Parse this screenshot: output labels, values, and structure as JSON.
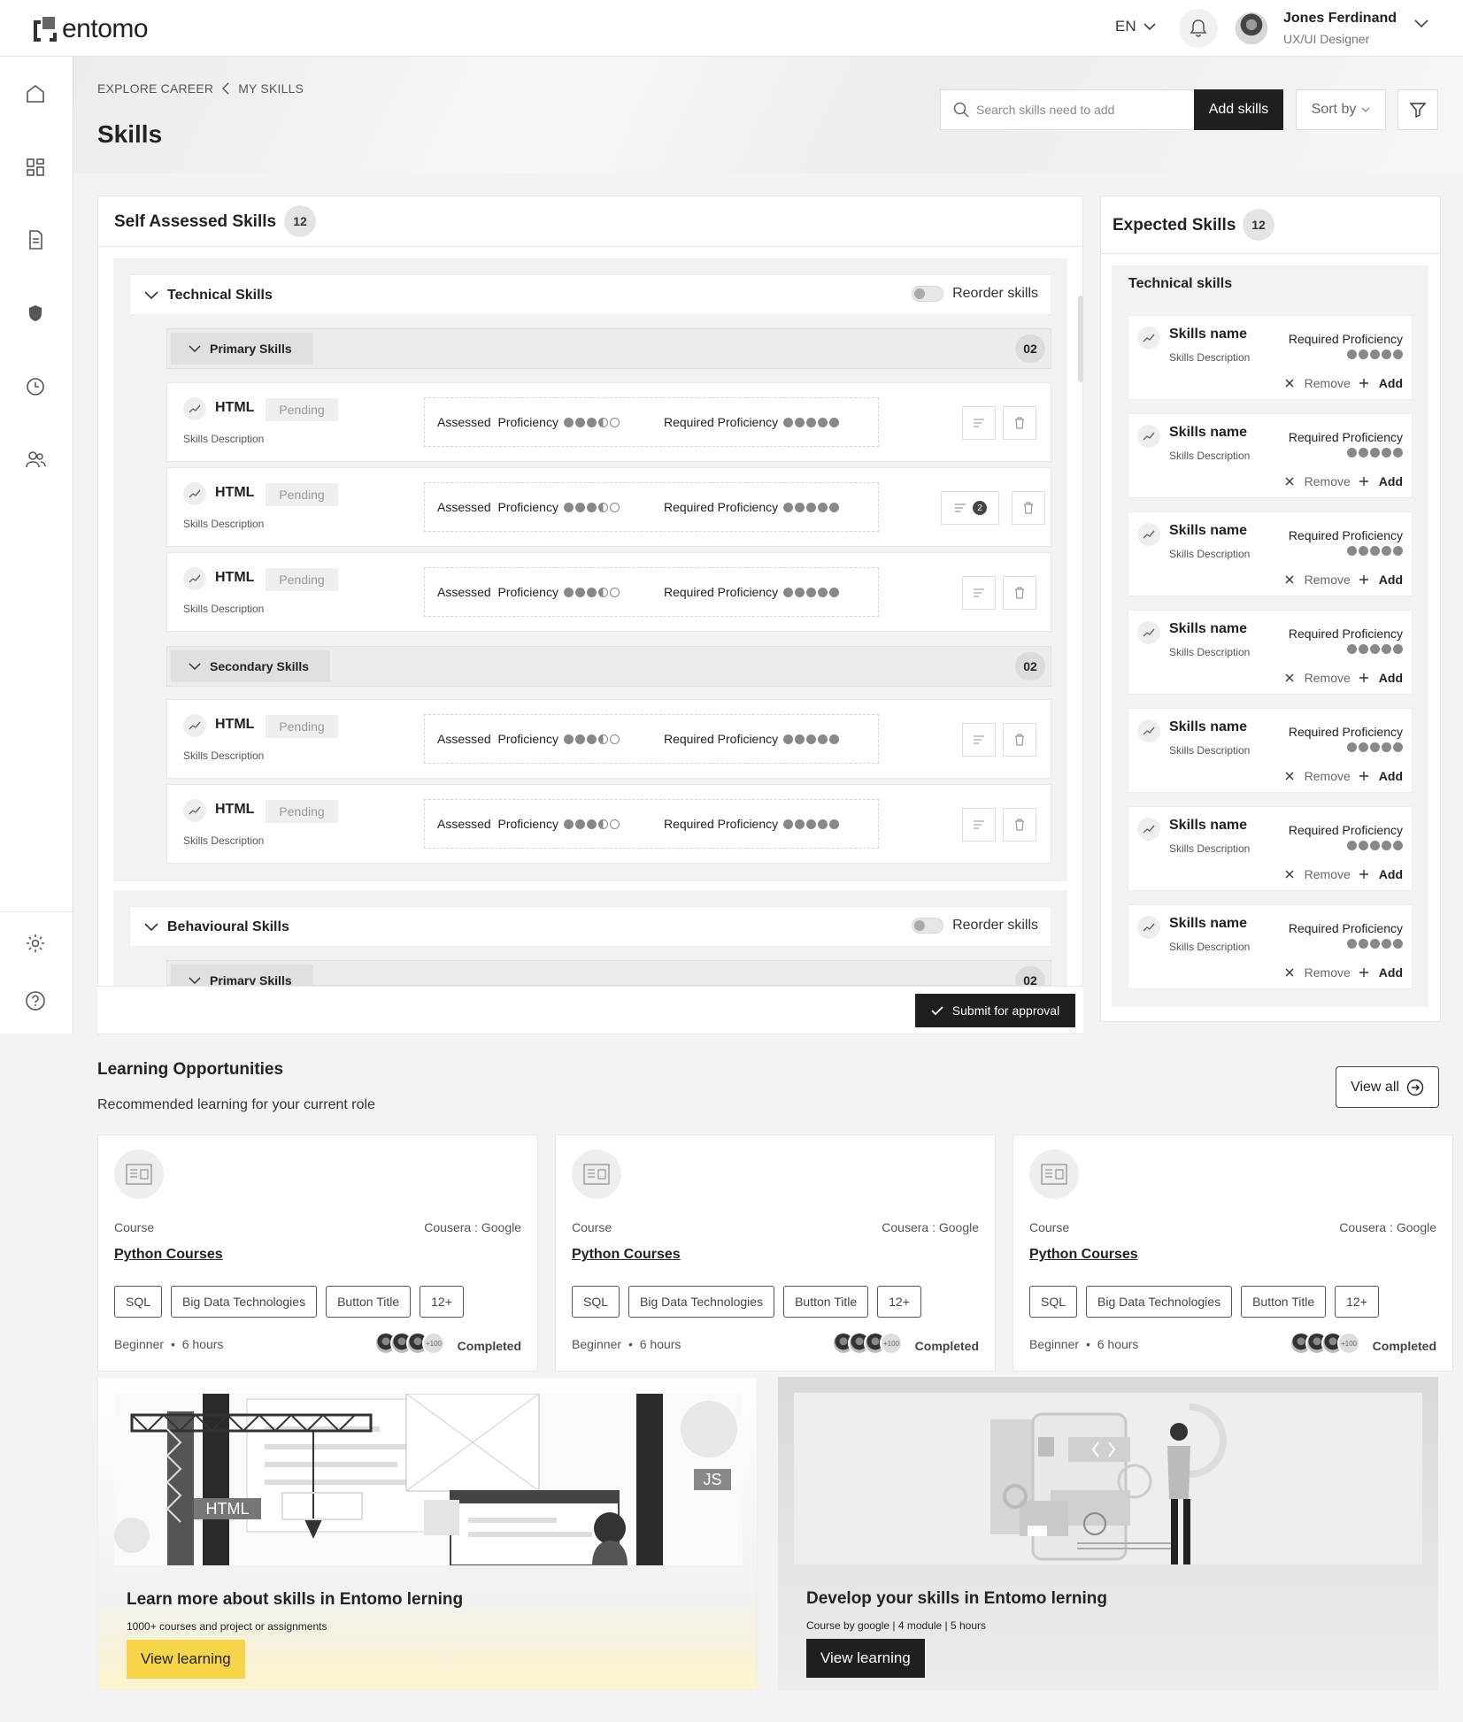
{
  "app": {
    "logo_text": "entomo",
    "language": "EN"
  },
  "user": {
    "name": "Jones Ferdinand",
    "role": "UX/UI Designer"
  },
  "sidebar": {
    "items": [
      "home-icon",
      "dashboard-icon",
      "document-icon",
      "shield-icon",
      "clock-icon",
      "people-icon",
      "settings-icon",
      "help-icon"
    ]
  },
  "breadcrumb": {
    "parent": "EXPLORE CAREER",
    "current": "MY SKILLS"
  },
  "page": {
    "title": "Skills"
  },
  "toolbar": {
    "search_placeholder": "Search skills need to add",
    "add_label": "Add skills",
    "sort_label": "Sort by"
  },
  "self_assessed": {
    "title": "Self Assessed Skills",
    "count": "12",
    "technical": {
      "title": "Technical Skills",
      "reorder_label": "Reorder skills",
      "primary": {
        "title": "Primary Skills",
        "count": "02"
      },
      "secondary": {
        "title": "Secondary Skills",
        "count": "02"
      },
      "rows": [
        {
          "name": "HTML",
          "status": "Pending",
          "desc": "Skills Description",
          "assessed_label": "Assessed  Proficiency",
          "assessed": 3.5,
          "required_label": "Required Proficiency",
          "required": 5,
          "comments": null
        },
        {
          "name": "HTML",
          "status": "Pending",
          "desc": "Skills Description",
          "assessed_label": "Assessed  Proficiency",
          "assessed": 3.5,
          "required_label": "Required Proficiency",
          "required": 5,
          "comments": "2"
        },
        {
          "name": "HTML",
          "status": "Pending",
          "desc": "Skills Description",
          "assessed_label": "Assessed  Proficiency",
          "assessed": 3.5,
          "required_label": "Required Proficiency",
          "required": 5,
          "comments": null
        },
        {
          "name": "HTML",
          "status": "Pending",
          "desc": "Skills Description",
          "assessed_label": "Assessed  Proficiency",
          "assessed": 3.5,
          "required_label": "Required Proficiency",
          "required": 5,
          "comments": null
        },
        {
          "name": "HTML",
          "status": "Pending",
          "desc": "Skills Description",
          "assessed_label": "Assessed  Proficiency",
          "assessed": 3.5,
          "required_label": "Required Proficiency",
          "required": 5,
          "comments": null
        }
      ]
    },
    "behavioural": {
      "title": "Behavioural Skills",
      "reorder_label": "Reorder skills",
      "primary": {
        "title": "Primary Skills",
        "count": "02"
      }
    },
    "submit_label": "Submit for approval"
  },
  "expected": {
    "title": "Expected Skills",
    "count": "12",
    "section_title": "Technical skills",
    "items": [
      {
        "name": "Skills name",
        "desc": "Skills Description",
        "req_label": "Required Proficiency",
        "required": 5,
        "remove": "Remove",
        "add": "Add"
      },
      {
        "name": "Skills name",
        "desc": "Skills Description",
        "req_label": "Required Proficiency",
        "required": 5,
        "remove": "Remove",
        "add": "Add"
      },
      {
        "name": "Skills name",
        "desc": "Skills Description",
        "req_label": "Required Proficiency",
        "required": 5,
        "remove": "Remove",
        "add": "Add"
      },
      {
        "name": "Skills name",
        "desc": "Skills Description",
        "req_label": "Required Proficiency",
        "required": 5,
        "remove": "Remove",
        "add": "Add"
      },
      {
        "name": "Skills name",
        "desc": "Skills Description",
        "req_label": "Required Proficiency",
        "required": 5,
        "remove": "Remove",
        "add": "Add"
      },
      {
        "name": "Skills name",
        "desc": "Skills Description",
        "req_label": "Required Proficiency",
        "required": 5,
        "remove": "Remove",
        "add": "Add"
      },
      {
        "name": "Skills name",
        "desc": "Skills Description",
        "req_label": "Required Proficiency",
        "required": 5,
        "remove": "Remove",
        "add": "Add"
      }
    ]
  },
  "learning": {
    "title": "Learning Opportunities",
    "subtitle": "Recommended learning for your  current role",
    "view_all": "View all",
    "courses": [
      {
        "type": "Course",
        "provider": "Cousera : Google",
        "title": "Python Courses",
        "tags": [
          "SQL",
          "Big Data Technologies",
          "Button Title",
          "12+"
        ],
        "level": "Beginner",
        "duration": "6 hours",
        "more": "+100",
        "status": "Completed"
      },
      {
        "type": "Course",
        "provider": "Cousera : Google",
        "title": "Python Courses",
        "tags": [
          "SQL",
          "Big Data Technologies",
          "Button Title",
          "12+"
        ],
        "level": "Beginner",
        "duration": "6 hours",
        "more": "+100",
        "status": "Completed"
      },
      {
        "type": "Course",
        "provider": "Cousera : Google",
        "title": "Python Courses",
        "tags": [
          "SQL",
          "Big Data Technologies",
          "Button Title",
          "12+"
        ],
        "level": "Beginner",
        "duration": "6 hours",
        "more": "+100",
        "status": "Completed"
      }
    ]
  },
  "banners": [
    {
      "title": "Learn more about skills in Entomo lerning",
      "subtitle": "1000+ courses and project or assignments",
      "button": "View learning",
      "illustration_labels": [
        "HTML",
        "JS"
      ],
      "accent": "#f7d54a"
    },
    {
      "title": "Develop your skills in Entomo lerning",
      "subtitle": "Course  by google | 4 module | 5 hours",
      "button": "View learning",
      "accent": "#1f1f1f"
    }
  ]
}
